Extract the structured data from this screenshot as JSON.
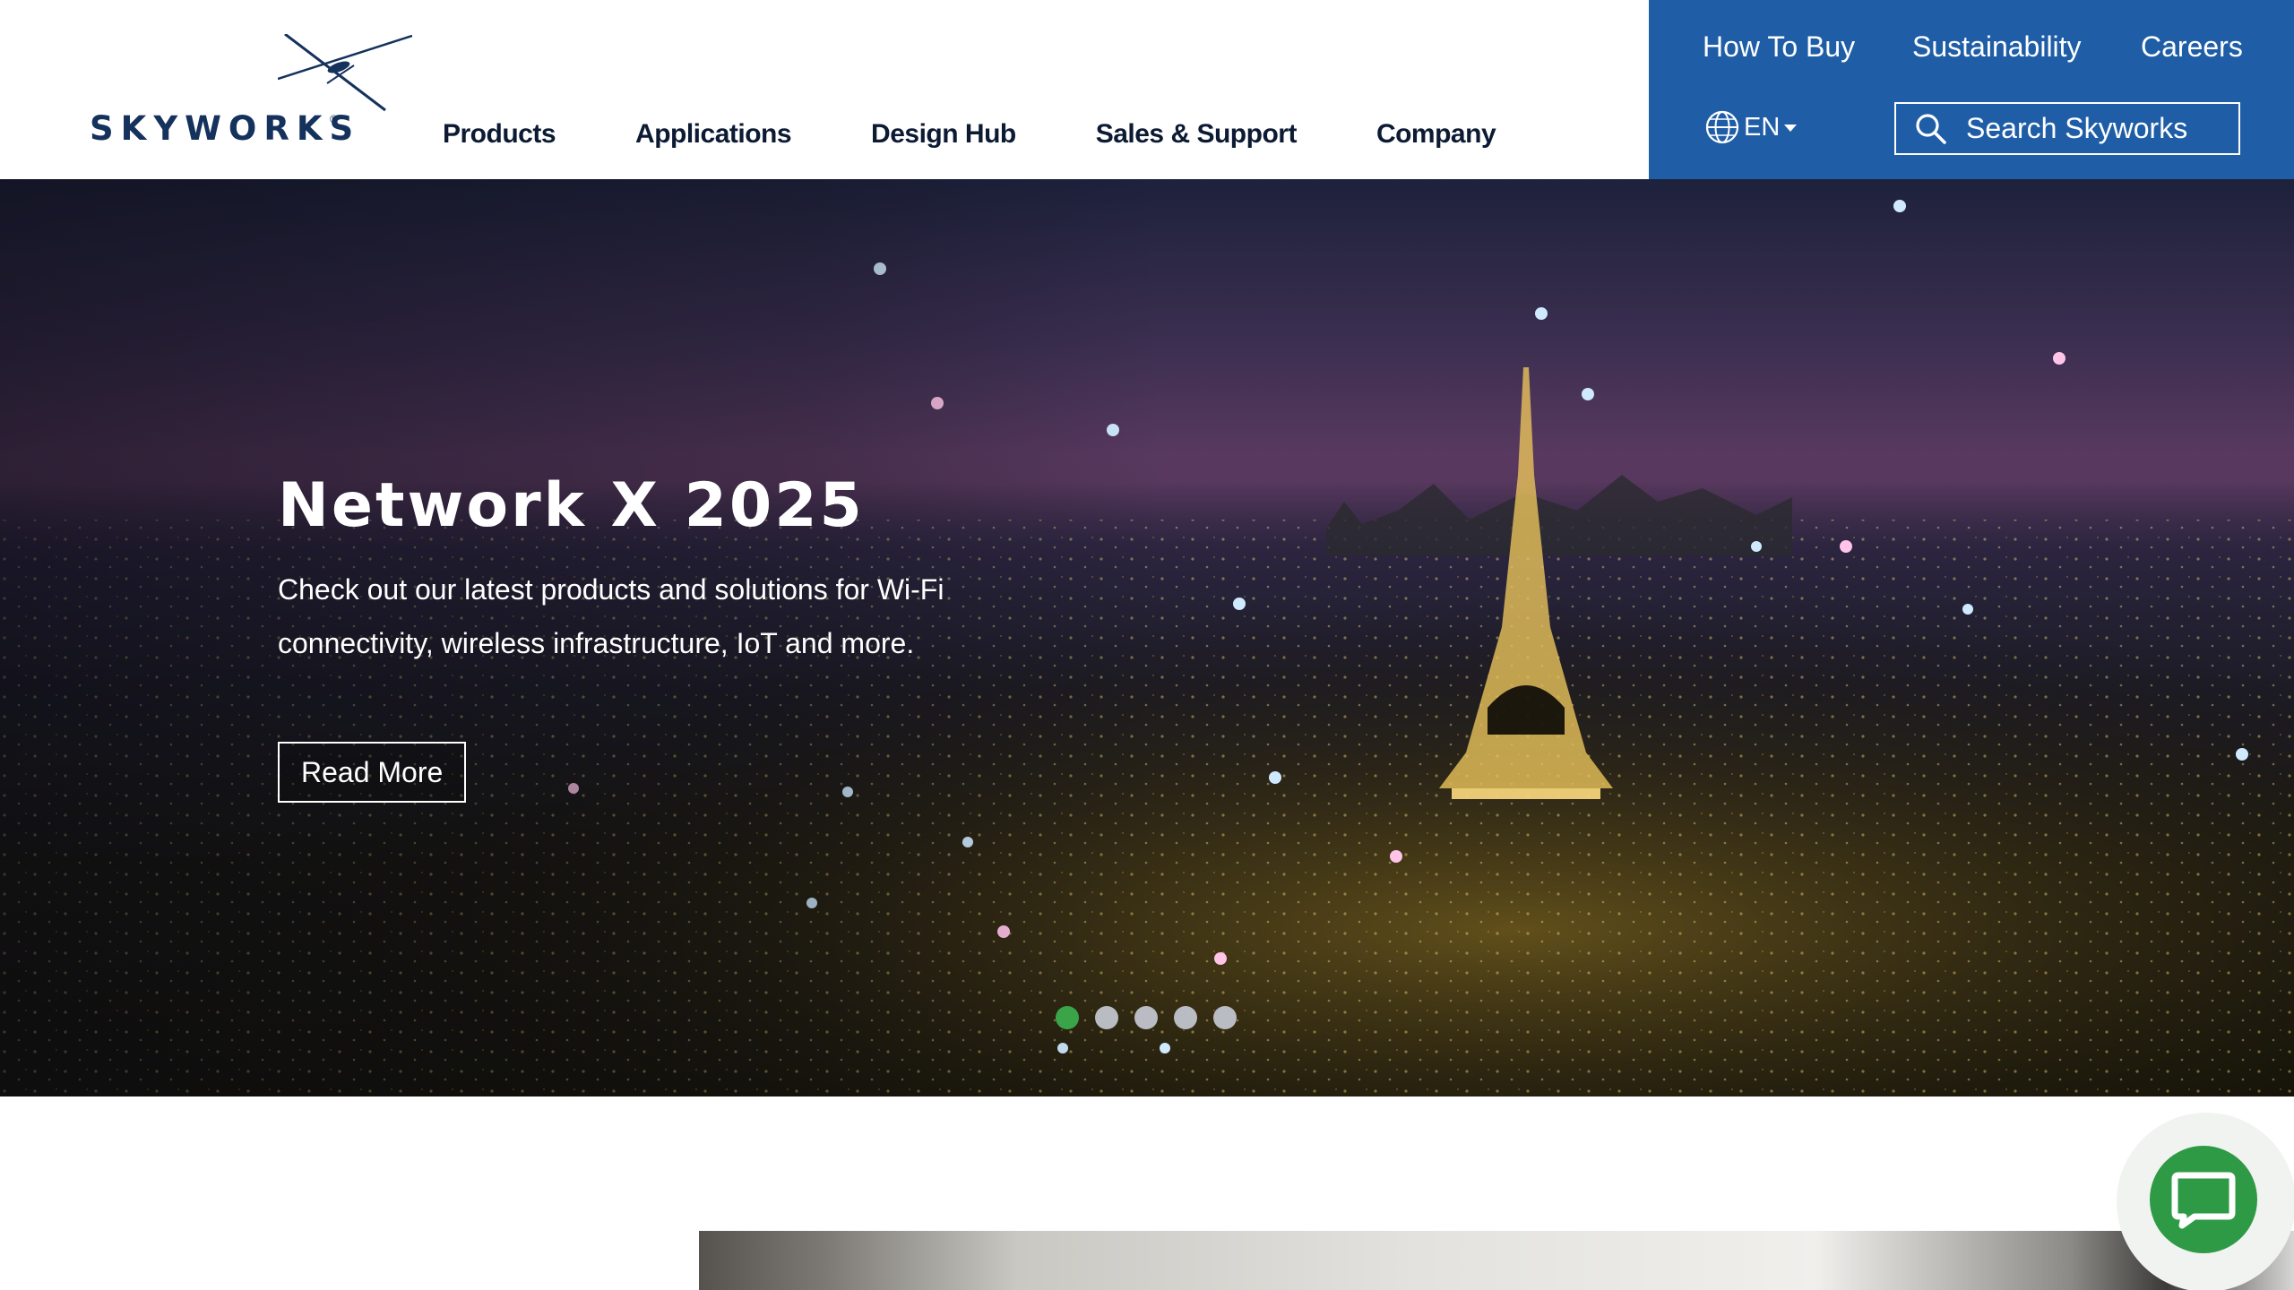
{
  "header": {
    "logo_text": "SKYWORKS",
    "logo_registered": "®",
    "main_nav": [
      {
        "label": "Products"
      },
      {
        "label": "Applications"
      },
      {
        "label": "Design Hub"
      },
      {
        "label": "Sales & Support"
      },
      {
        "label": "Company"
      }
    ],
    "utility_links": [
      {
        "label": "How To Buy"
      },
      {
        "label": "Sustainability"
      },
      {
        "label": "Careers"
      }
    ],
    "language": "EN",
    "search": {
      "placeholder": "Search Skyworks",
      "value": ""
    },
    "colors": {
      "utility_panel": "#1f5ea7",
      "nav_text": "#0c1a33",
      "logo": "#15325d"
    }
  },
  "hero": {
    "title": "Network X 2025",
    "description": "Check out our latest products and solutions for Wi-Fi connectivity, wireless infrastructure, IoT and more.",
    "cta_label": "Read More",
    "slides_total": 5,
    "active_slide": 1,
    "colors": {
      "active_dot": "#3aa548",
      "inactive_dot": "#b9bcc2"
    }
  },
  "icons": {
    "globe": "globe-icon",
    "search": "search-icon",
    "chat": "chat-icon",
    "caret": "caret-down-icon"
  }
}
